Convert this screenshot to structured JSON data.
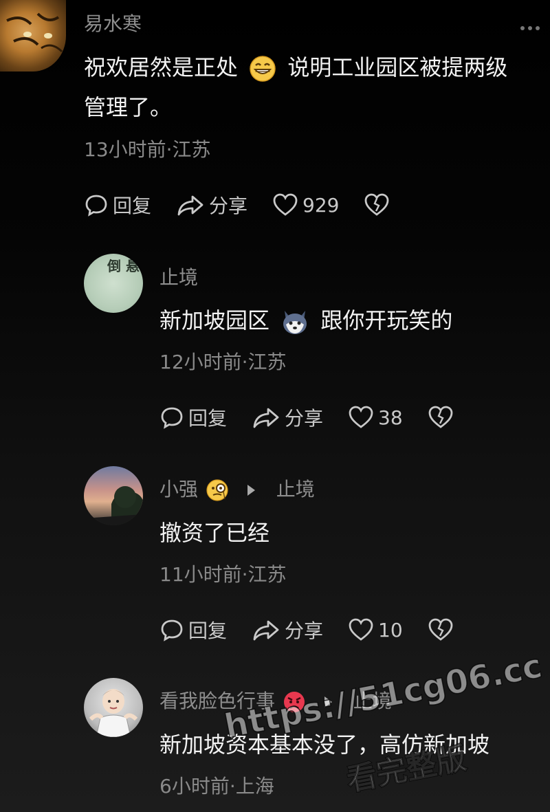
{
  "comments": [
    {
      "user": "易水寒",
      "text_line1_a": "祝欢居然是正处",
      "text_line1_b": "说明工业园区被提两级",
      "text_line2": "管理了。",
      "meta": "13小时前·江苏",
      "reply_label": "回复",
      "share_label": "分享",
      "likes": "929"
    },
    {
      "user": "止境",
      "avatar_text": "倒 悬 山",
      "text_a": "新加坡园区",
      "text_b": "跟你开玩笑的",
      "meta": "12小时前·江苏",
      "reply_label": "回复",
      "share_label": "分享",
      "likes": "38"
    },
    {
      "user": "小强",
      "reply_to": "止境",
      "text": "撤资了已经",
      "meta": "11小时前·江苏",
      "reply_label": "回复",
      "share_label": "分享",
      "likes": "10"
    },
    {
      "user": "看我脸色行事",
      "reply_to": "止境",
      "text": "新加坡资本基本没了，高仿新加坡",
      "meta": "6小时前·上海"
    }
  ],
  "watermark": {
    "url": "https://51cg06.cc",
    "label": "看完整版"
  },
  "icons": {
    "reply": "speech-bubble-icon",
    "share": "share-arrow-icon",
    "like": "heart-icon",
    "dislike": "broken-heart-icon",
    "more": "more-dots-icon"
  },
  "colors": {
    "background": "#000000",
    "primary_text": "#f2f2f2",
    "secondary_text": "#8a8a8a"
  }
}
